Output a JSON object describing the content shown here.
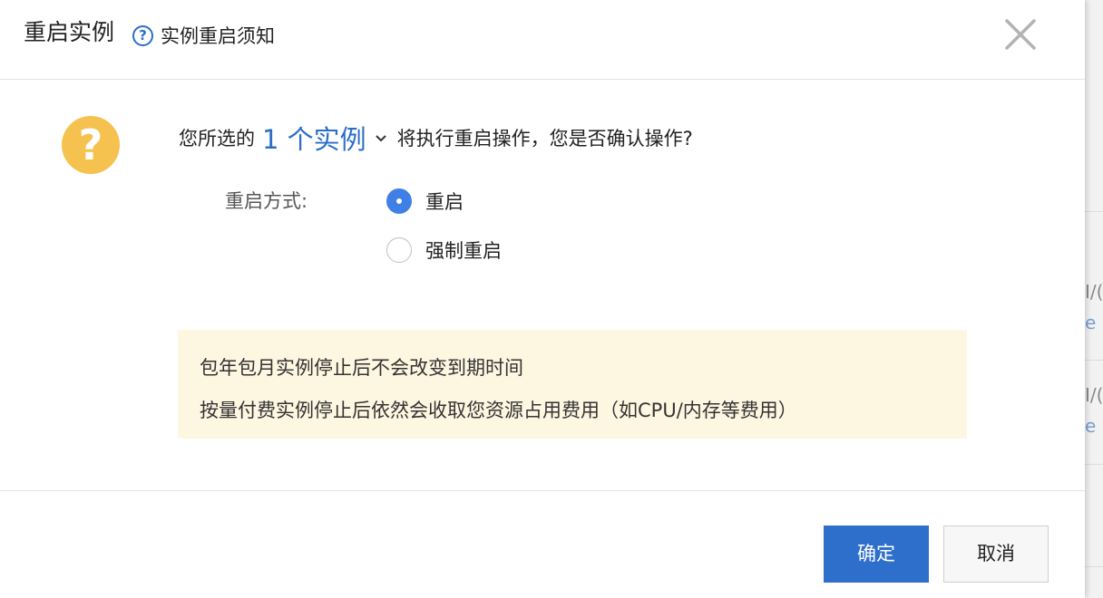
{
  "background": {
    "rows": [
      {
        "top_text": "I/(",
        "bottom_text": "e"
      },
      {
        "top_text": "I/(",
        "bottom_text": "e"
      }
    ]
  },
  "dialog": {
    "title": "重启实例",
    "help_icon": "question-circle-icon",
    "help_link": "实例重启须知",
    "close_icon": "close-x-icon",
    "warning_icon": "question-mark-icon",
    "warning_glyph": "?",
    "confirm": {
      "prefix": "您所选的",
      "instance_count": "1 个实例",
      "suffix": "将执行重启操作，您是否确认操作?"
    },
    "restart_method": {
      "label": "重启方式:",
      "options": [
        {
          "label": "重启",
          "checked": true
        },
        {
          "label": "强制重启",
          "checked": false
        }
      ]
    },
    "notice": {
      "lines": [
        "包年包月实例停止后不会改变到期时间",
        "按量付费实例停止后依然会收取您资源占用费用（如CPU/内存等费用）"
      ]
    },
    "buttons": {
      "confirm": "确定",
      "cancel": "取消"
    }
  },
  "colors": {
    "primary": "#2d6fcb",
    "link": "#2b6ec8",
    "warning": "#f5c14f",
    "notice_bg": "#fdf6e1",
    "radio_checked": "#3f7fe6"
  }
}
